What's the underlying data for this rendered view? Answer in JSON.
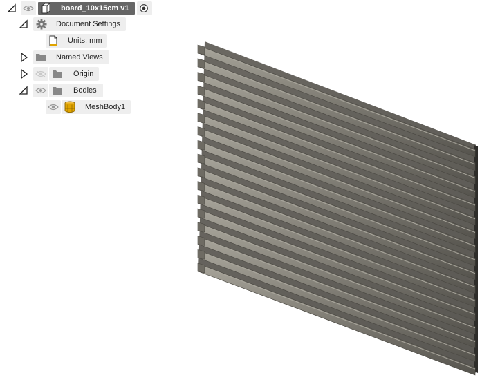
{
  "browser": {
    "root": {
      "label": "board_10x15cm v1"
    },
    "nodes": {
      "document_settings": {
        "label": "Document Settings"
      },
      "units": {
        "label": "Units: mm"
      },
      "named_views": {
        "label": "Named Views"
      },
      "origin": {
        "label": "Origin"
      },
      "bodies": {
        "label": "Bodies"
      },
      "meshbody": {
        "label": "MeshBody1"
      }
    }
  },
  "model": {
    "name": "board_10x15cm",
    "rib_count": 17,
    "colors": {
      "face": "#7d7a72",
      "edge": "#4a4842",
      "highlight": "#a8a59b"
    }
  },
  "icons": [
    "expand-triangle-icon",
    "collapse-triangle-icon",
    "eye-icon",
    "eye-hidden-icon",
    "component-icon",
    "radio-icon",
    "gear-icon",
    "document-icon",
    "folder-icon",
    "mesh-body-icon"
  ]
}
